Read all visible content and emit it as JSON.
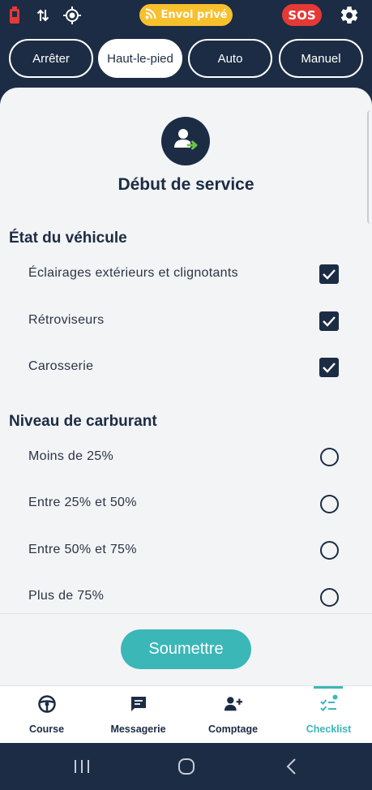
{
  "topbar": {
    "envoi_label": "Envoi privé",
    "sos_label": "SOS"
  },
  "modes": [
    {
      "label": "Arrêter",
      "active": false
    },
    {
      "label": "Haut-le-pied",
      "active": true
    },
    {
      "label": "Auto",
      "active": false
    },
    {
      "label": "Manuel",
      "active": false
    }
  ],
  "form": {
    "title": "Début de service",
    "sections": [
      {
        "title": "État du véhicule",
        "type": "checkbox",
        "items": [
          {
            "label": "Éclairages extérieurs et clignotants",
            "checked": true
          },
          {
            "label": "Rétroviseurs",
            "checked": true
          },
          {
            "label": "Carosserie",
            "checked": true
          }
        ]
      },
      {
        "title": "Niveau de carburant",
        "type": "radio",
        "items": [
          {
            "label": "Moins de 25%",
            "checked": false
          },
          {
            "label": "Entre 25% et 50%",
            "checked": false
          },
          {
            "label": "Entre 50% et 75%",
            "checked": false
          },
          {
            "label": "Plus de 75%",
            "checked": false
          }
        ]
      }
    ],
    "submit_label": "Soumettre"
  },
  "bottom_nav": [
    {
      "label": "Course",
      "icon": "steering-wheel-icon",
      "active": false
    },
    {
      "label": "Messagerie",
      "icon": "chat-icon",
      "active": false
    },
    {
      "label": "Comptage",
      "icon": "add-person-icon",
      "active": false
    },
    {
      "label": "Checklist",
      "icon": "checklist-icon",
      "active": true
    }
  ],
  "colors": {
    "navy": "#1c2c44",
    "teal": "#3bb7b8",
    "yellow": "#f7c02d",
    "red": "#e53935",
    "sheet_bg": "#f3f4f6"
  }
}
